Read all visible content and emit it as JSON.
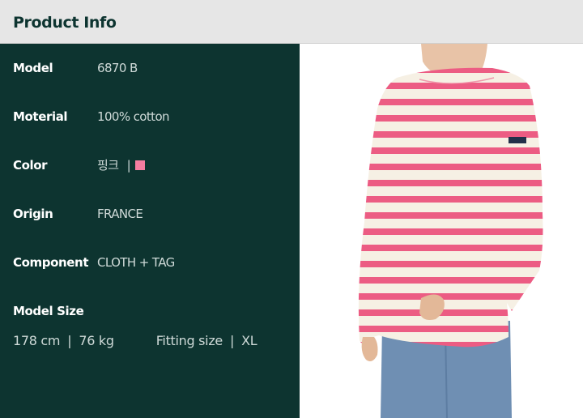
{
  "header": {
    "title": "Product Info"
  },
  "specs": [
    {
      "label": "Model",
      "value": "6870 B"
    },
    {
      "label": "Moterial",
      "value": "100% cotton"
    },
    {
      "label": "Color",
      "value": "핑크",
      "separator": "|",
      "swatch_color": "#f47da0"
    },
    {
      "label": "Origin",
      "value": "FRANCE"
    },
    {
      "label": "Component",
      "value": "CLOTH + TAG"
    }
  ],
  "model_size": {
    "label": "Model Size",
    "height": "178 cm",
    "weight": "76 kg",
    "fitting_label": "Fitting size",
    "fitting_value": "XL",
    "separator": "|"
  },
  "colors": {
    "panel_bg": "#0d3430",
    "header_bg": "#e6e6e6",
    "stripe_pink": "#ec5c83",
    "shirt_cream": "#f6f0e4",
    "jeans_blue": "#6f8fb3"
  },
  "image": {
    "subject": "model-wearing-pink-striped-long-sleeve-shirt"
  }
}
